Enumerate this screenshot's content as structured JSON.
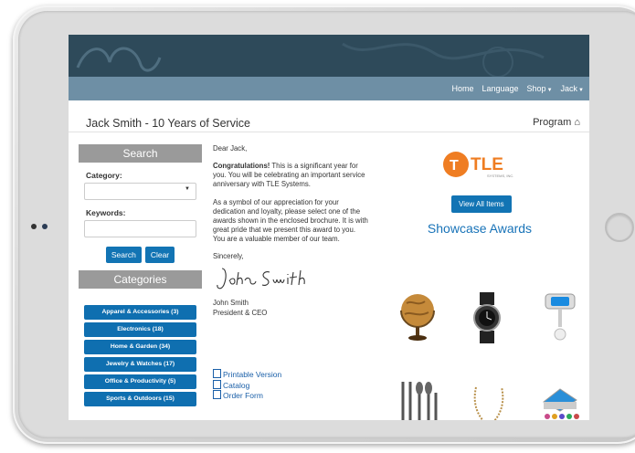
{
  "nav": {
    "home": "Home",
    "language": "Language",
    "shop": "Shop",
    "user": "Jack"
  },
  "title": "Jack Smith - 10 Years of Service",
  "program": "Program",
  "search": {
    "header": "Search",
    "category_label": "Category:",
    "keywords_label": "Keywords:",
    "search_btn": "Search",
    "clear_btn": "Clear"
  },
  "categories": {
    "header": "Categories",
    "items": [
      "Apparel & Accessories (3)",
      "Electronics (18)",
      "Home & Garden (34)",
      "Jewelry & Watches (17)",
      "Office & Productivity (5)",
      "Sports & Outdoors (15)"
    ]
  },
  "letter": {
    "greeting": "Dear Jack,",
    "p1_bold": "Congratulations!",
    "p1_rest": " This is a significant year for you. You will be celebrating an important service anniversary with TLE Systems.",
    "p2": "As a symbol of our appreciation for your dedication and loyalty, please select one of the awards shown in the enclosed brochure. It is with great pride that we present this award to you. You are a valuable member of our team.",
    "closing": "Sincerely,",
    "signature": "John Smith",
    "name": "John Smith",
    "position": "President & CEO"
  },
  "links": [
    "Printable Version",
    "Catalog",
    "Order Form"
  ],
  "logo": {
    "text": "TLE",
    "sub": "SYSTEMS, INC."
  },
  "view_all": "View All Items",
  "showcase": "Showcase Awards",
  "colors": {
    "banner": "#2e4a5a",
    "nav": "#6e8fa5",
    "primary": "#1274b4",
    "logo_orange": "#ef7d22"
  }
}
